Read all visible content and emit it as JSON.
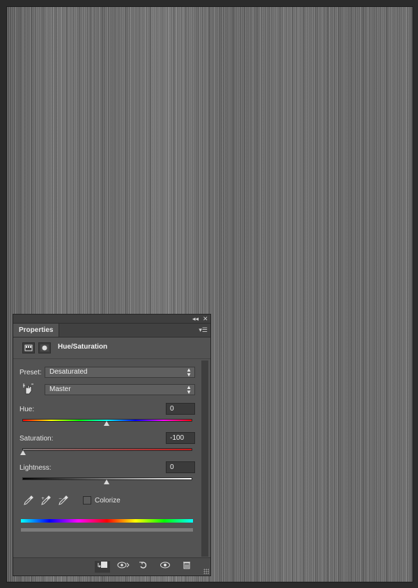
{
  "panel": {
    "tab_label": "Properties",
    "title": "Hue/Saturation",
    "preset": {
      "label": "Preset:",
      "value": "Desaturated"
    },
    "channel": {
      "value": "Master"
    },
    "hue": {
      "label": "Hue:",
      "value": "0"
    },
    "saturation": {
      "label": "Saturation:",
      "value": "-100"
    },
    "lightness": {
      "label": "Lightness:",
      "value": "0"
    },
    "colorize": {
      "label": "Colorize",
      "checked": false
    }
  },
  "colors": {
    "panel_bg": "#535353",
    "canvas_gray": "#6c6c6c"
  },
  "icons": {
    "collapse": "double-chevron-left-icon",
    "close": "close-icon",
    "menu": "panel-menu-icon",
    "adjustment": "adjustment-layer-icon",
    "mask": "mask-icon",
    "target": "targeted-adjustment-icon",
    "eyedroppers": [
      "eyedropper-icon",
      "eyedropper-plus-icon",
      "eyedropper-minus-icon"
    ],
    "footer": [
      "clip-to-layer-icon",
      "view-previous-icon",
      "reset-icon",
      "visibility-icon",
      "delete-icon"
    ]
  }
}
